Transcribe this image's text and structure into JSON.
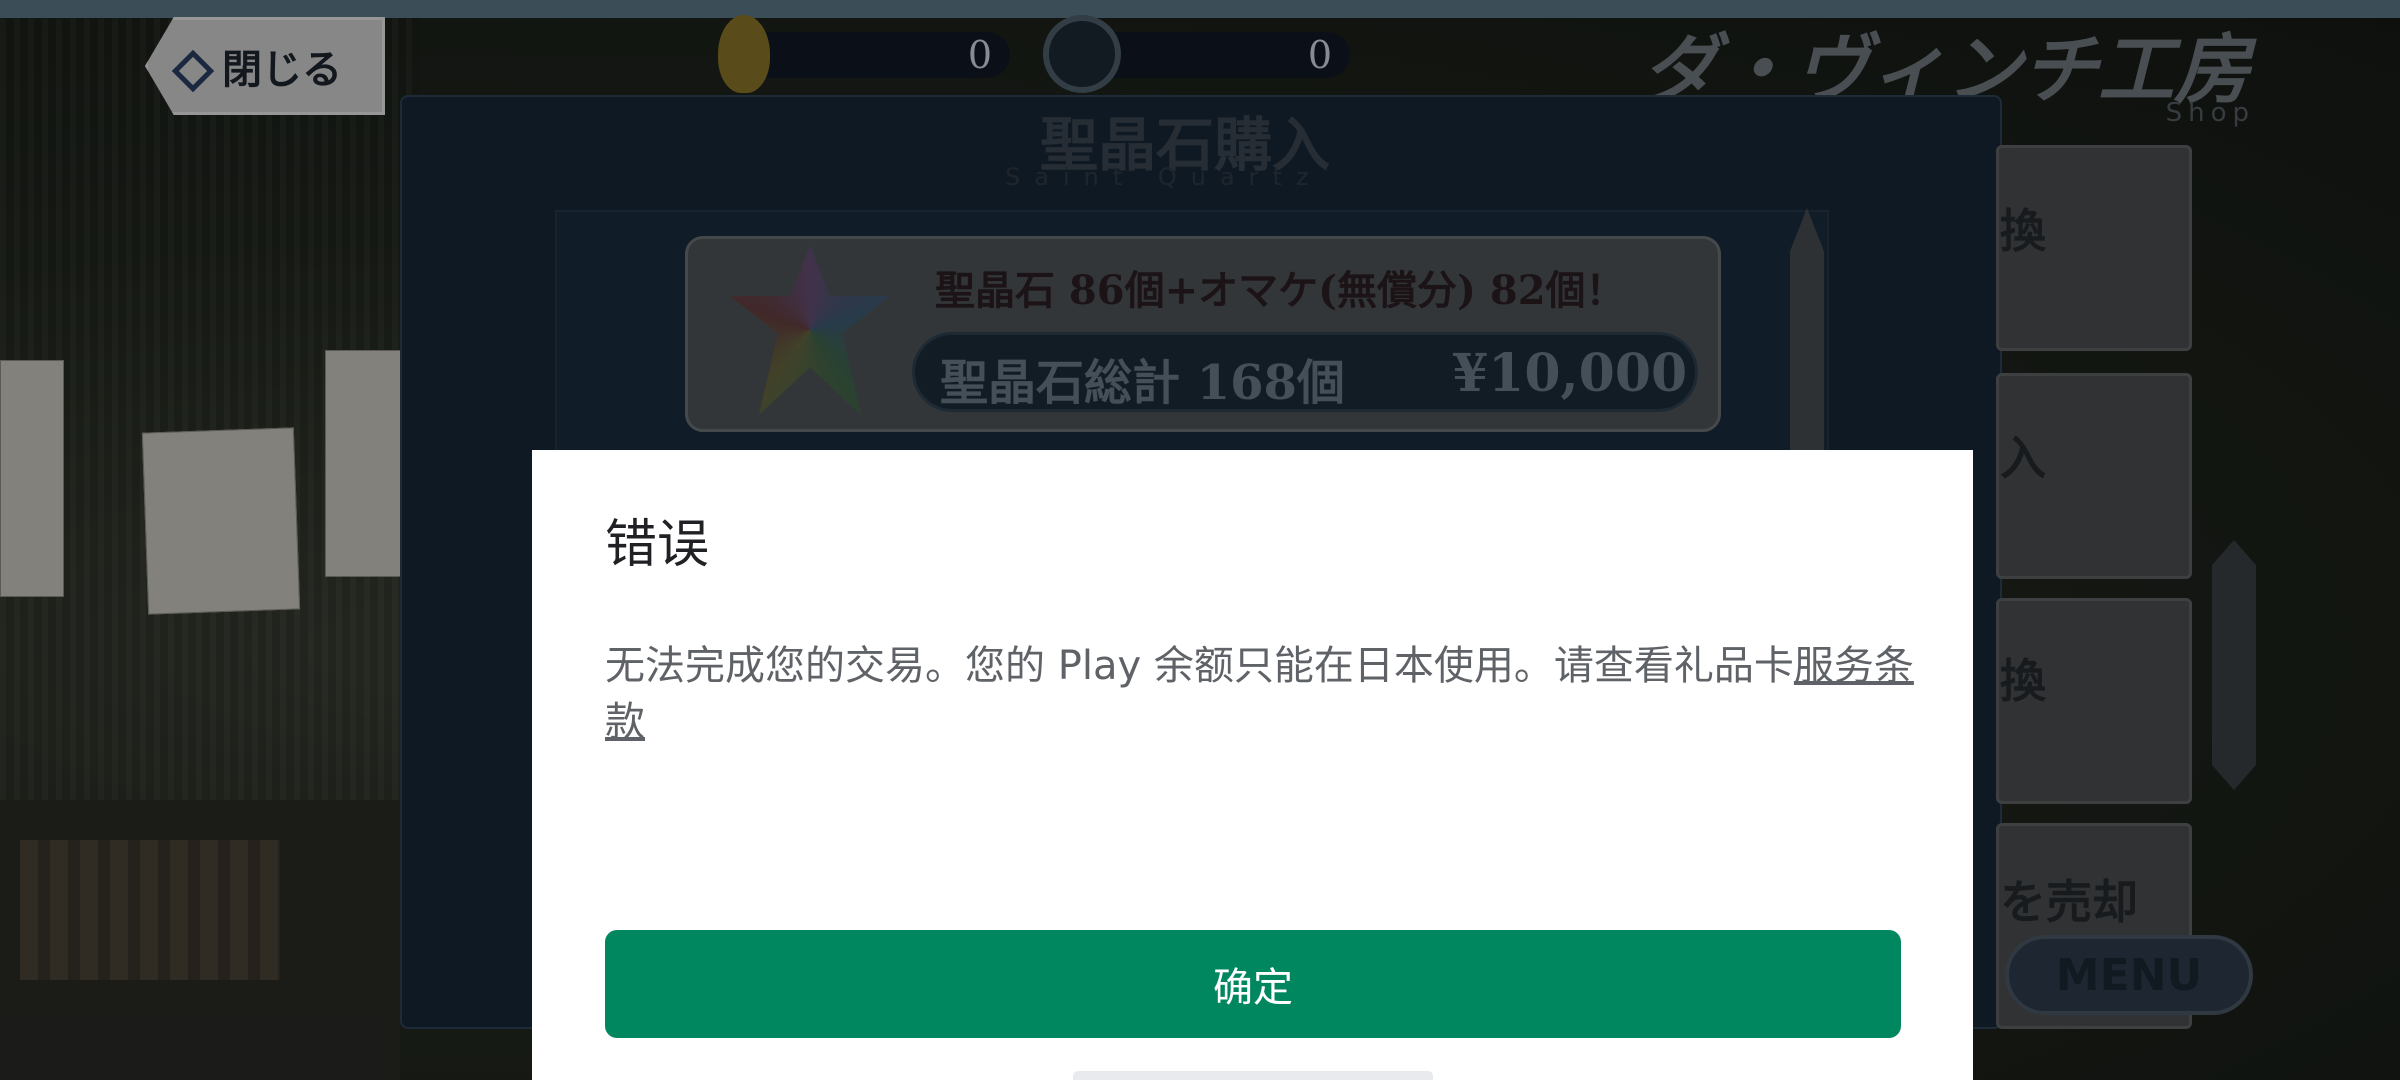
{
  "background": {
    "close_label": "閉じる",
    "currency": {
      "quartz_count": "0",
      "other_count": "0"
    },
    "shop": {
      "title": "ダ・ヴィンチ工房",
      "subtitle": "Shop"
    },
    "panel": {
      "title": "聖晶石購入",
      "subtitle": "Saint Quartz"
    },
    "product": {
      "title": "聖晶石 86個+オマケ(無償分) 82個！",
      "total_label": "聖晶石総計 168個",
      "price": "¥10,000"
    },
    "right_menu": [
      "換",
      "入",
      "換",
      "を売却"
    ],
    "menu_label": "MENU"
  },
  "dialog": {
    "title": "错误",
    "message": "无法完成您的交易。您的 Play 余额只能在日本使用。请查看礼品卡",
    "link_text": "服务条款",
    "confirm_label": "确定",
    "accent_color": "#01875f"
  }
}
